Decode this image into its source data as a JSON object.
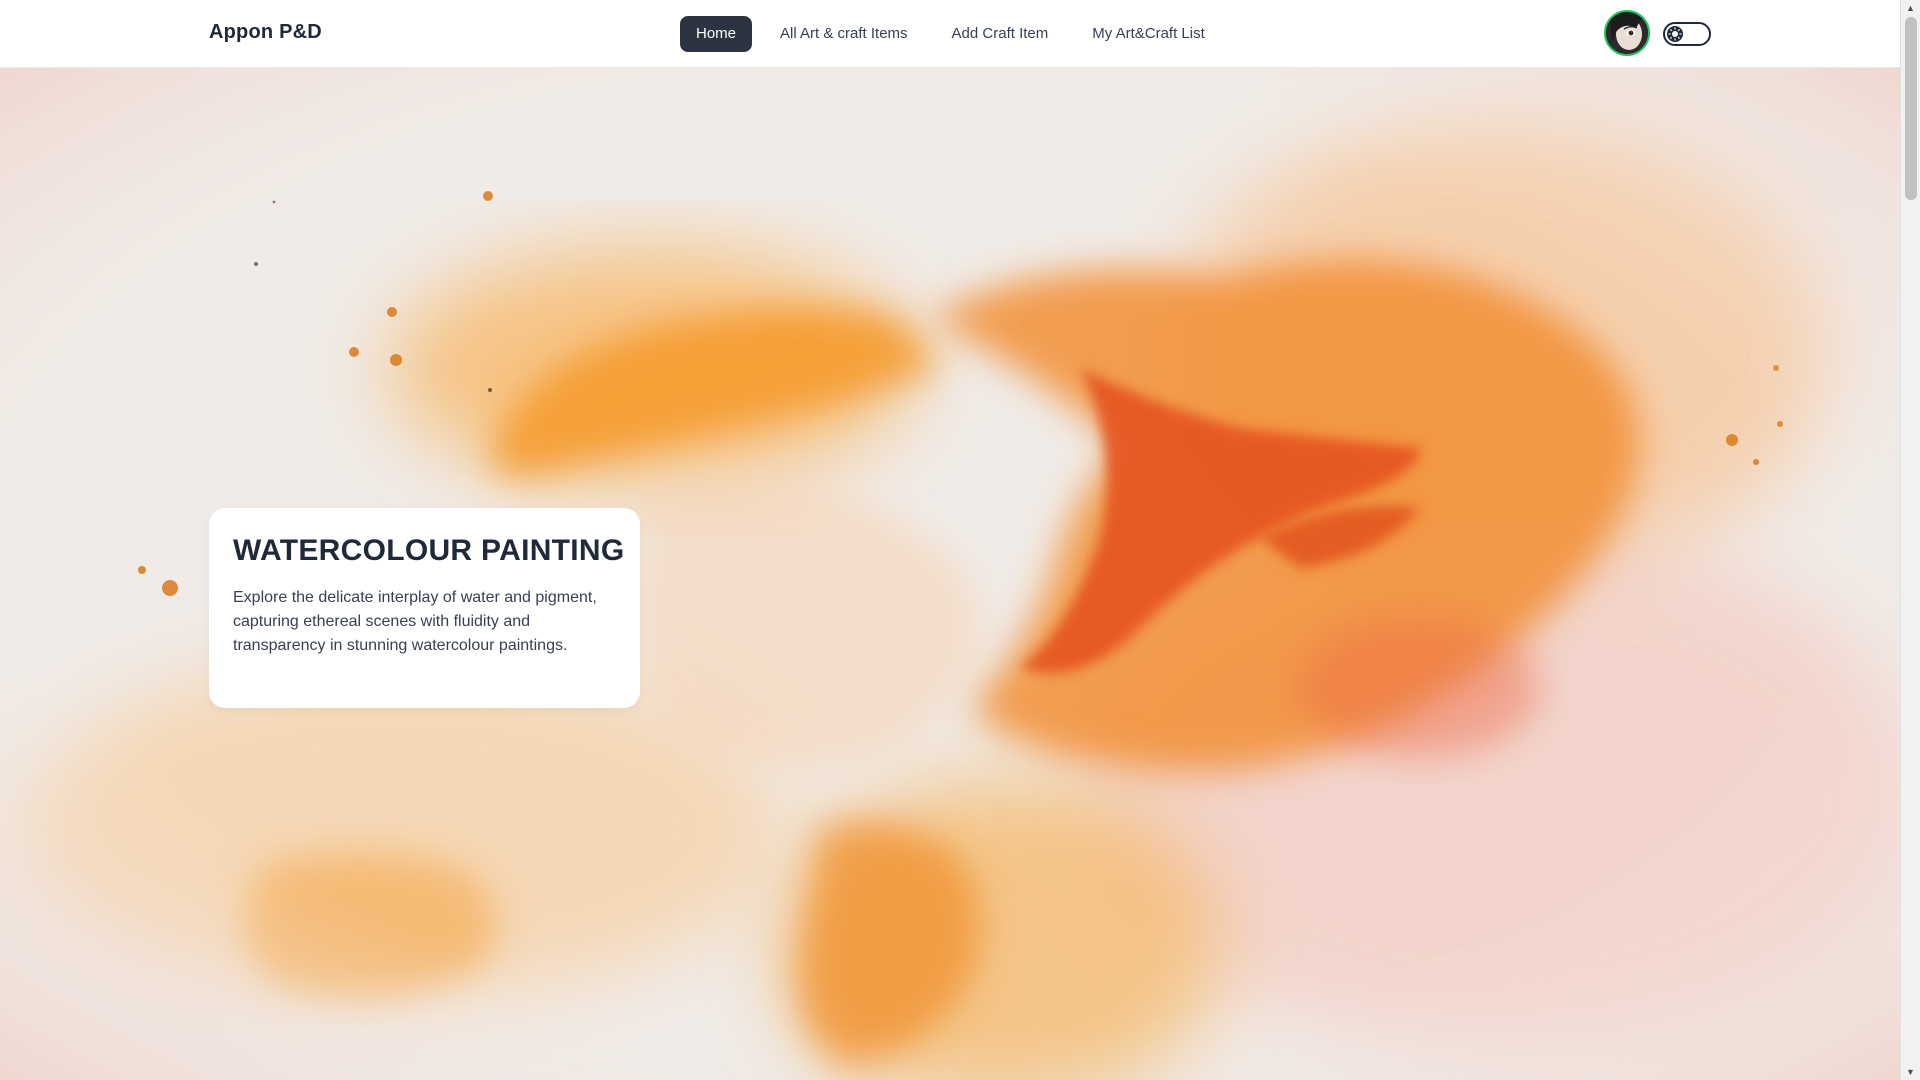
{
  "header": {
    "brand": "Appon P&D",
    "nav": [
      {
        "label": "Home",
        "active": true
      },
      {
        "label": "All Art & craft Items",
        "active": false
      },
      {
        "label": "Add Craft Item",
        "active": false
      },
      {
        "label": "My Art&Craft List",
        "active": false
      }
    ],
    "avatar_icon": "user-avatar",
    "theme_toggle_icon": "sun-icon"
  },
  "hero": {
    "title": "WATERCOLOUR PAINTING",
    "description": "Explore the delicate interplay of water and pigment, capturing ethereal scenes with fluidity and transparency in stunning watercolour paintings.",
    "background_image": "orange watercolour splash",
    "colors": {
      "accent_orange": "#f28c1e",
      "accent_red": "#e5501a",
      "accent_yellow": "#f7b733"
    }
  },
  "colors": {
    "nav_active_bg": "#2b3440",
    "text_primary": "#1f2937",
    "avatar_ring": "#22c55e"
  }
}
